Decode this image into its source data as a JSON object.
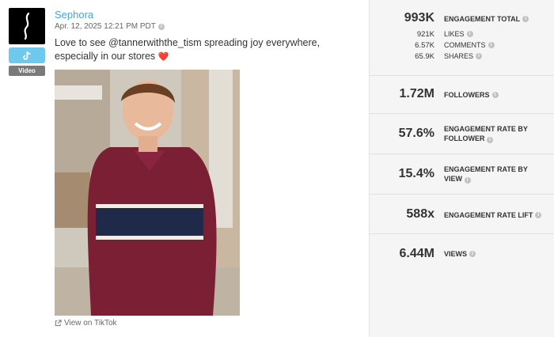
{
  "post": {
    "author": "Sephora",
    "timestamp": "Apr. 12, 2025 12:21 PM PDT",
    "caption": "Love to see @tannerwiththe_tism spreading joy everywhere, especially in our stores",
    "caption_emoji": "❤️",
    "media_type": "Video",
    "view_link": "View on TikTok",
    "platform_icon": "tiktok-icon",
    "colors": {
      "author_link": "#4aa3df",
      "platform_badge": "#6ec9ec",
      "heart": "#e0323f"
    }
  },
  "stats": {
    "engagement_total": {
      "value": "993K",
      "label": "ENGAGEMENT TOTAL"
    },
    "breakdown": [
      {
        "value": "921K",
        "label": "LIKES"
      },
      {
        "value": "6.57K",
        "label": "COMMENTS"
      },
      {
        "value": "65.9K",
        "label": "SHARES"
      }
    ],
    "followers": {
      "value": "1.72M",
      "label": "FOLLOWERS"
    },
    "engagement_rate_follower": {
      "value": "57.6%",
      "label_line1": "ENGAGEMENT RATE BY",
      "label_line2": "FOLLOWER"
    },
    "engagement_rate_view": {
      "value": "15.4%",
      "label_line1": "ENGAGEMENT RATE BY",
      "label_line2": "VIEW"
    },
    "engagement_rate_lift": {
      "value": "588x",
      "label": "ENGAGEMENT RATE LIFT"
    },
    "views": {
      "value": "6.44M",
      "label": "VIEWS"
    }
  }
}
